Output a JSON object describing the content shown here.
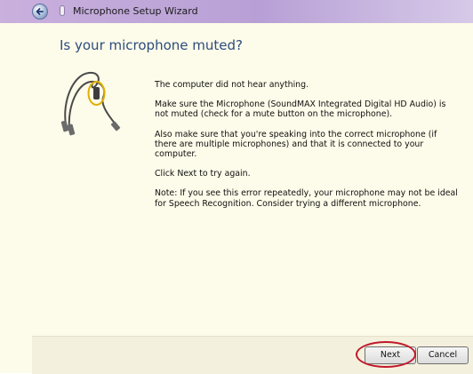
{
  "window": {
    "title": "Microphone Setup Wizard"
  },
  "page": {
    "heading": "Is your microphone muted?",
    "paragraphs": [
      "The computer did not hear anything.",
      "Make sure the Microphone (SoundMAX Integrated Digital HD Audio) is not muted (check for a mute button on the microphone).",
      "Also make sure that you're speaking into the correct microphone (if there are multiple microphones) and that it is connected to your computer.",
      "Click Next to try again.",
      "Note: If you see this error repeatedly, your microphone may not be ideal for Speech Recognition. Consider trying a different microphone."
    ]
  },
  "buttons": {
    "next_label": "Next",
    "cancel_label": "Cancel"
  },
  "icons": {
    "back": "back-arrow-icon",
    "title": "microphone-icon",
    "illustration": "headset-cable-with-mute-switch"
  },
  "colors": {
    "heading": "#2d4c7e",
    "highlight_ring": "#c0182a",
    "inline_switch_ring": "#e0b000"
  }
}
